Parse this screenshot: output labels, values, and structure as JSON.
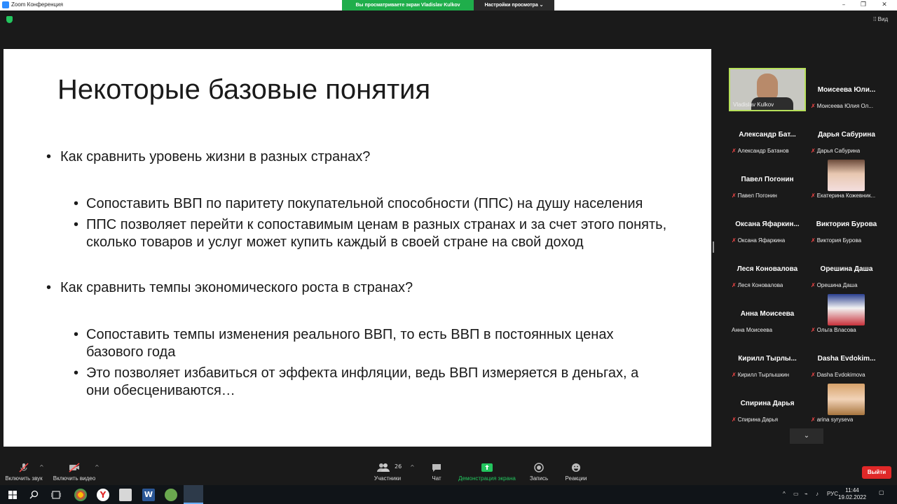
{
  "window": {
    "title": "Zoom Конференция",
    "minimize": "–",
    "restore": "❐",
    "close": "✕"
  },
  "share": {
    "banner": "Вы просматриваете экран Vladislav Kulkov",
    "view_settings": "Настройки просмотра ⌄",
    "view_button": "Вид"
  },
  "slide": {
    "title": "Некоторые базовые понятия",
    "q1": "Как сравнить уровень жизни в разных странах?",
    "q1_a1": "Сопоставить ВВП по паритету покупательной способности (ППС) на душу населения",
    "q1_a2": "ППС позволяет перейти к сопоставимым ценам в разных странах и за счет этого понять, сколько товаров и услуг может купить каждый в своей стране на свой доход",
    "q2": "Как сравнить темпы экономического роста в странах?",
    "q2_a1": "Сопоставить темпы изменения реального ВВП, то есть ВВП в постоянных ценах базового года",
    "q2_a2": "Это позволяет избавиться от эффекта инфляции, ведь ВВП измеряется в деньгах, а они обесцениваются…"
  },
  "participants": [
    {
      "name": "",
      "label": "Vladislav Kulkov",
      "muted": false
    },
    {
      "name": "Моисеева Юли...",
      "label": "Моисеева Юлия Ол...",
      "muted": true
    },
    {
      "name": "Александр Бат...",
      "label": "Александр Батанов",
      "muted": true
    },
    {
      "name": "Дарья Сабурина",
      "label": "Дарья Сабурина",
      "muted": true
    },
    {
      "name": "Павел Погонин",
      "label": "Павел Погонин",
      "muted": true
    },
    {
      "name": "",
      "label": "Екатерина Кожевник...",
      "muted": true
    },
    {
      "name": "Оксана Яфаркин...",
      "label": "Оксана Яфаркина",
      "muted": true
    },
    {
      "name": "Виктория Бурова",
      "label": "Виктория Бурова",
      "muted": true
    },
    {
      "name": "Леся Коновалова",
      "label": "Леся Коновалова",
      "muted": true
    },
    {
      "name": "Орешина Даша",
      "label": "Орешина Даша",
      "muted": true
    },
    {
      "name": "Анна Моисеева",
      "label": "Анна Моисеева",
      "muted": false
    },
    {
      "name": "",
      "label": "Ольга Власова",
      "muted": true
    },
    {
      "name": "Кирилл Тырлы...",
      "label": "Кирилл Тырлышкин",
      "muted": true
    },
    {
      "name": "Dasha Evdokim...",
      "label": "Dasha Evdokimova",
      "muted": true
    },
    {
      "name": "Спирина Дарья",
      "label": "Спирина Дарья",
      "muted": true
    },
    {
      "name": "",
      "label": "arina syryseva",
      "muted": true
    }
  ],
  "mic_glyph": "✗",
  "toolbar": {
    "unmute": "Включить звук",
    "start_video": "Включить видео",
    "participants": "Участники",
    "participants_count": "26",
    "chat": "Чат",
    "share_screen": "Демонстрация экрана",
    "record": "Запись",
    "reactions": "Реакции",
    "leave": "Выйти",
    "caret": "^",
    "gallery_down": "⌄"
  },
  "taskbar": {
    "lang": "РУС",
    "time": "11:44",
    "date": "19.02.2022",
    "tray_up": "^"
  },
  "colors": {
    "share_green": "#1fae4b",
    "leave_red": "#e02828",
    "active_speaker": "#b7e05a",
    "muted_red": "#ff4848"
  }
}
